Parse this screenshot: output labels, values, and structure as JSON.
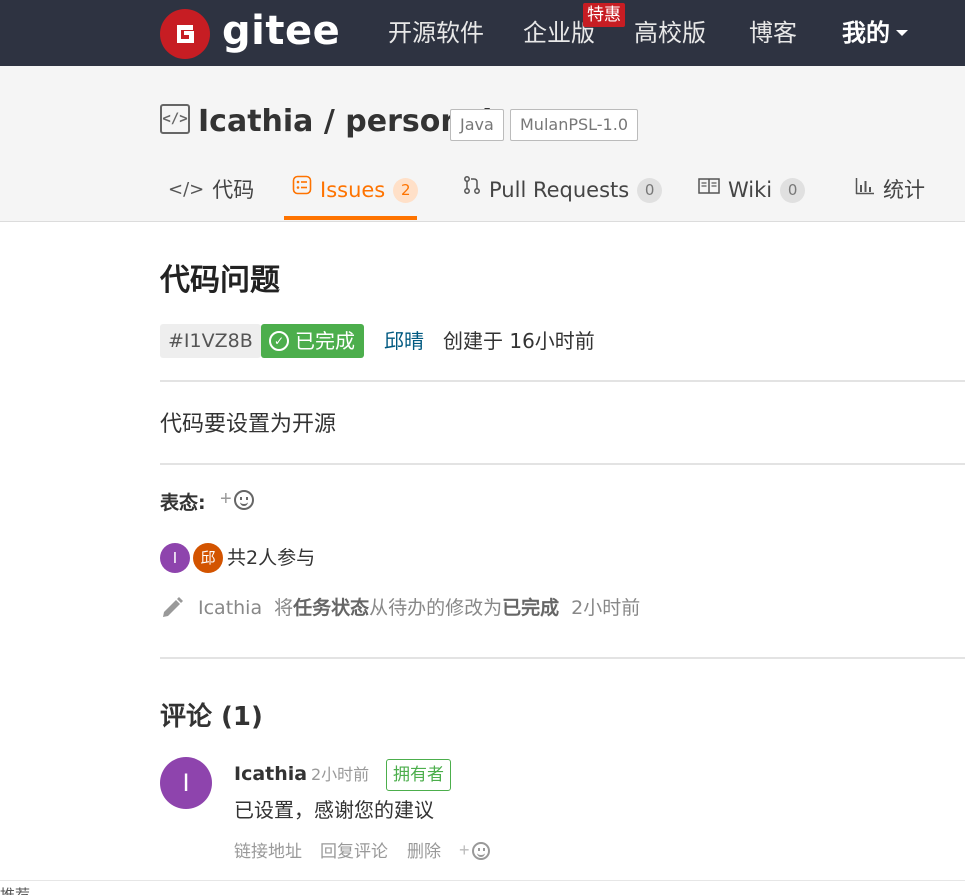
{
  "topnav": {
    "brand": "gitee",
    "items": [
      "开源软件",
      "企业版",
      "高校版",
      "博客"
    ],
    "promo_badge": "特惠",
    "mine": "我的",
    "colors": {
      "bar": "#2e3341",
      "brand": "#c71d23"
    }
  },
  "repo": {
    "title": "Icathia / personal",
    "language": "Java",
    "license": "MulanPSL-1.0"
  },
  "tabs": [
    {
      "label": "代码",
      "icon": "code-icon"
    },
    {
      "label": "Issues",
      "icon": "issues-icon",
      "count": "2",
      "active": true
    },
    {
      "label": "Pull Requests",
      "icon": "pull-request-icon",
      "count": "0"
    },
    {
      "label": "Wiki",
      "icon": "book-icon",
      "count": "0"
    },
    {
      "label": "统计",
      "icon": "bar-chart-icon"
    }
  ],
  "issue": {
    "title": "代码问题",
    "id": "#I1VZ8B",
    "status": "已完成",
    "author": "邱晴",
    "created": "创建于 16小时前",
    "body": "代码要设置为开源",
    "reactions_label": "表态:",
    "participants": {
      "avatars": [
        {
          "initial": "I",
          "color": "#8e44ad"
        },
        {
          "initial": "邱",
          "color": "#d35400"
        }
      ],
      "text": "共2人参与"
    },
    "activity": {
      "user": "Icathia",
      "prefix": "将",
      "field": "任务状态",
      "middle": "从待办的修改为",
      "new_value": "已完成",
      "time": "2小时前"
    }
  },
  "comments": {
    "title": "评论 (1)",
    "items": [
      {
        "avatar_initial": "I",
        "author": "Icathia",
        "time": "2小时前",
        "role": "拥有者",
        "body": "已设置，感谢您的建议",
        "actions": [
          "链接地址",
          "回复评论",
          "删除"
        ]
      }
    ]
  },
  "footer_cut_text": "推荐",
  "colors": {
    "accent": "#fe7300",
    "success": "#4cae4c",
    "link": "#005980"
  }
}
